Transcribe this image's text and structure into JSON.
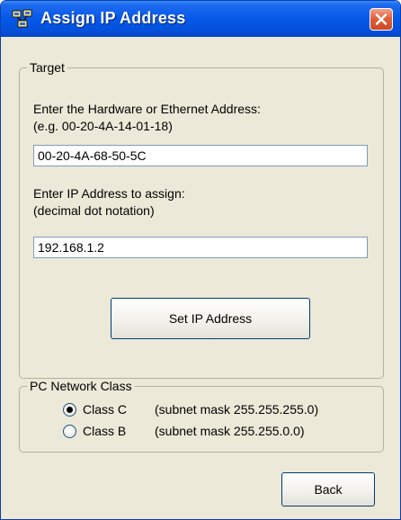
{
  "window": {
    "title": "Assign IP Address",
    "close_label": "Close"
  },
  "target": {
    "legend": "Target",
    "hw_label_line1": "Enter the Hardware or Ethernet Address:",
    "hw_label_line2": "(e.g. 00-20-4A-14-01-18)",
    "hw_value": "00-20-4A-68-50-5C",
    "ip_label_line1": "Enter IP Address to assign:",
    "ip_label_line2": "(decimal dot notation)",
    "ip_value": "192.168.1.2",
    "set_button": "Set IP Address"
  },
  "network": {
    "legend": "PC Network Class",
    "options": [
      {
        "label": "Class C",
        "mask": "(subnet mask 255.255.255.0)",
        "selected": true
      },
      {
        "label": "Class B",
        "mask": "(subnet mask 255.255.0.0)",
        "selected": false
      }
    ]
  },
  "back_button": "Back",
  "colors": {
    "titlebar": "#0558e8",
    "close": "#e0603e",
    "face": "#ece9d8",
    "radio_dot": "#21a121"
  },
  "icons": {
    "app": "network-app-icon",
    "close": "close-icon"
  }
}
